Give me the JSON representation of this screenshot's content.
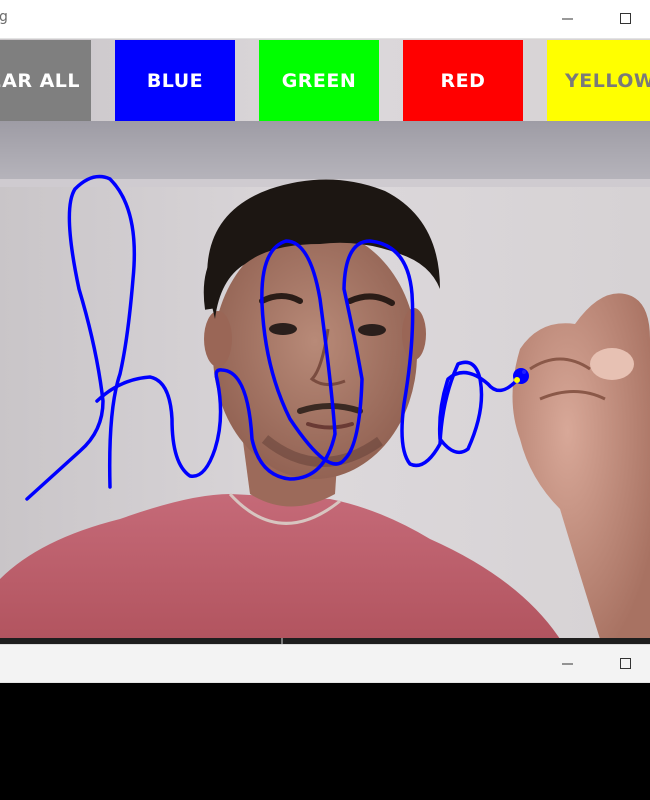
{
  "window_top": {
    "title": "g",
    "minimize_label": "",
    "maximize_label": ""
  },
  "window_bottom": {
    "title": "",
    "minimize_label": "",
    "maximize_label": ""
  },
  "palette": {
    "buttons": [
      {
        "id": "clear",
        "label": "EAR ALL",
        "color": "#7f7f7f"
      },
      {
        "id": "blue",
        "label": "BLUE",
        "color": "#0000ff"
      },
      {
        "id": "green",
        "label": "GREEN",
        "color": "#00ff00"
      },
      {
        "id": "red",
        "label": "RED",
        "color": "#ff0000"
      },
      {
        "id": "yellow",
        "label": "YELLOW",
        "color": "#ffff00"
      }
    ]
  },
  "canvas": {
    "ink_color": "#0000ff",
    "pointer_marker_color": "#ffff00"
  }
}
